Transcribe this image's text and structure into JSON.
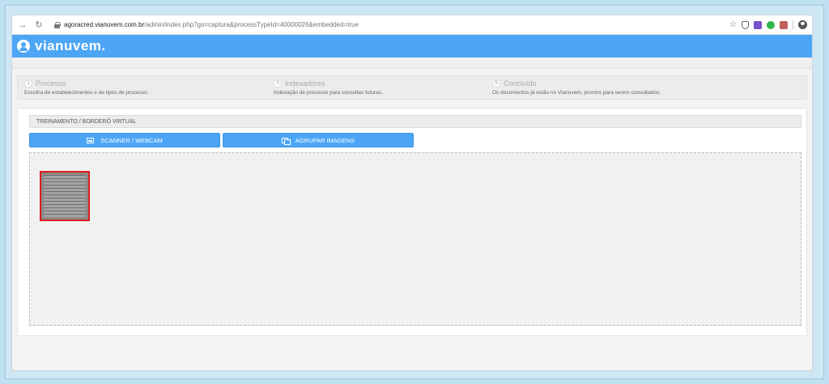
{
  "browser": {
    "url_host": "agoracred.vianuvem.com.br",
    "url_path": "/admin/index.php?go=captura&processTypeId=40000026&embedded=true"
  },
  "app": {
    "brand": "vianuvem."
  },
  "steps": [
    {
      "number": "1",
      "title": "Processo",
      "description": "Escolha de estabelecimentos e de tipos de processo."
    },
    {
      "number": "3",
      "title": "Indexadores",
      "description": "Indexação de processo para consultas futuras."
    },
    {
      "number": "5",
      "title": "Concluído",
      "description": "Os documentos já estão no Vianuvem, prontos para serem consultados."
    }
  ],
  "content": {
    "document_title": "TREINAMENTO / BORDERÔ VIRTUAL",
    "scanner_button": "SCANNER / WEBCAM",
    "group_button": "AGRUPAR IMAGENS"
  },
  "colors": {
    "accent": "#4da6f5",
    "thumbnail_border": "#e01b1b"
  }
}
